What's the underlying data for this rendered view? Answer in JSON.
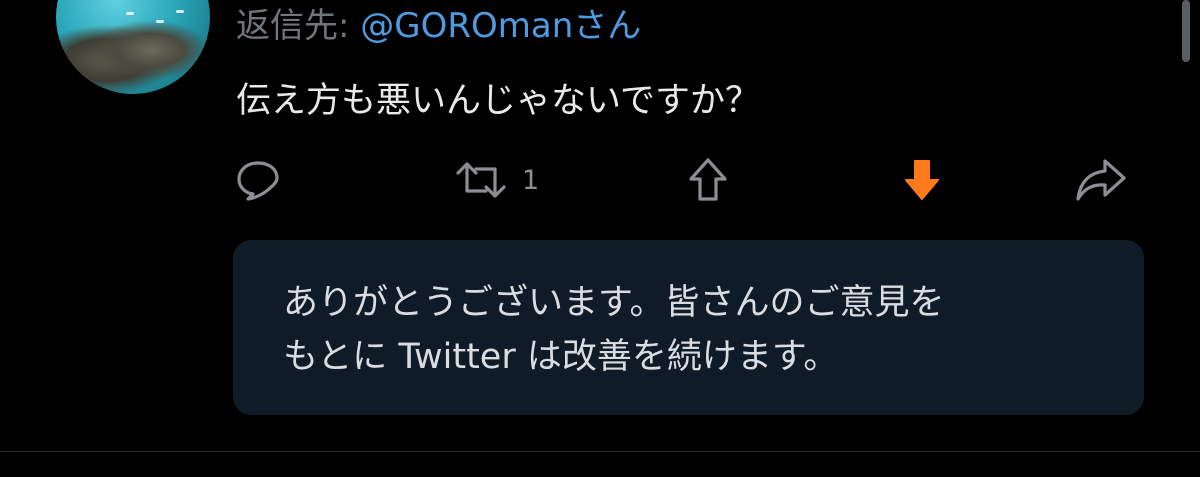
{
  "reply": {
    "prefix": "返信先: ",
    "handle": "@GOROman",
    "suffix": "さん"
  },
  "tweet": {
    "text": "伝え方も悪いんじゃないですか？"
  },
  "actions": {
    "reply_icon": "speech-bubble-icon",
    "retweet_icon": "retweet-icon",
    "retweet_count": "1",
    "upvote_icon": "up-arrow-outline-icon",
    "downvote_icon": "down-arrow-filled-icon",
    "share_icon": "share-arrow-icon",
    "downvote_color": "#ff7a1a",
    "icon_color": "#8b8f94"
  },
  "notice": {
    "line1": "ありがとうございます。皆さんのご意見を",
    "line2": "もとに Twitter は改善を続けます。"
  },
  "colors": {
    "background": "#000000",
    "link": "#4f9be0",
    "notice_background": "#0f1b26"
  }
}
